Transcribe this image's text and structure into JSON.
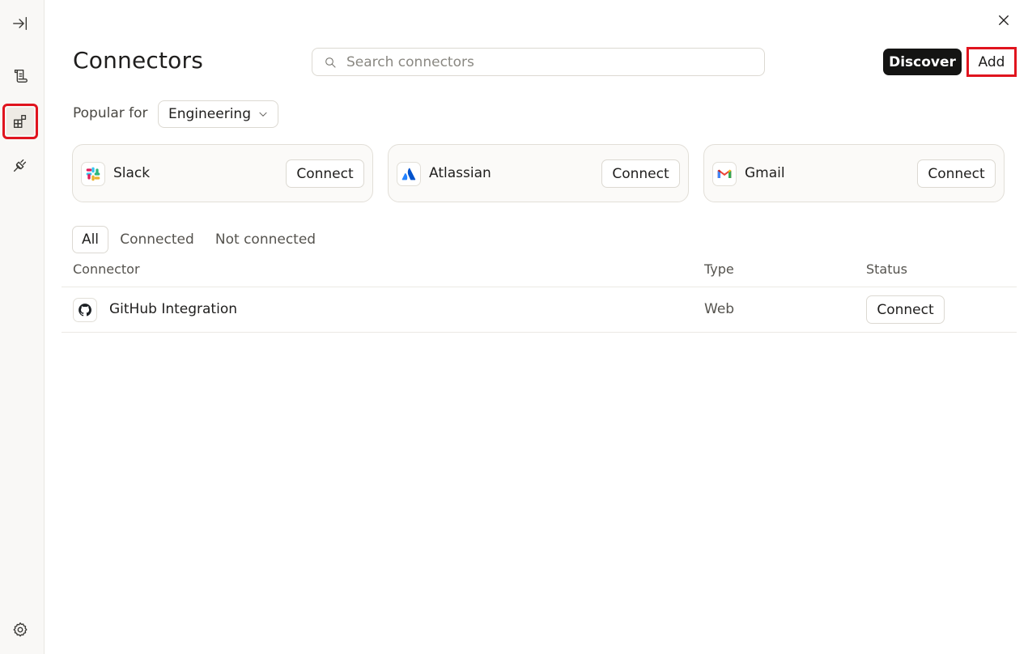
{
  "header": {
    "title": "Connectors",
    "search_placeholder": "Search connectors",
    "search_value": "",
    "discover_label": "Discover",
    "add_label": "Add"
  },
  "popular": {
    "label": "Popular for",
    "selected": "Engineering"
  },
  "cards": [
    {
      "name": "Slack",
      "icon": "slack-icon",
      "action": "Connect"
    },
    {
      "name": "Atlassian",
      "icon": "atlassian-icon",
      "action": "Connect"
    },
    {
      "name": "Gmail",
      "icon": "gmail-icon",
      "action": "Connect"
    }
  ],
  "filters": [
    "All",
    "Connected",
    "Not connected"
  ],
  "active_filter": "All",
  "table": {
    "columns": [
      "Connector",
      "Type",
      "Status"
    ],
    "rows": [
      {
        "name": "GitHub Integration",
        "icon": "github-icon",
        "type": "Web",
        "status": "Connect"
      }
    ]
  },
  "sidebar": {
    "items": [
      {
        "icon": "expand-sidebar-icon"
      },
      {
        "icon": "scroll-icon"
      },
      {
        "icon": "connectors-icon",
        "selected": true
      },
      {
        "icon": "plug-icon"
      },
      {
        "icon": "gear-icon"
      }
    ]
  },
  "colors": {
    "highlight": "#e0141e",
    "primary_button": "#141413",
    "rail_bg": "#f9f8f6"
  }
}
